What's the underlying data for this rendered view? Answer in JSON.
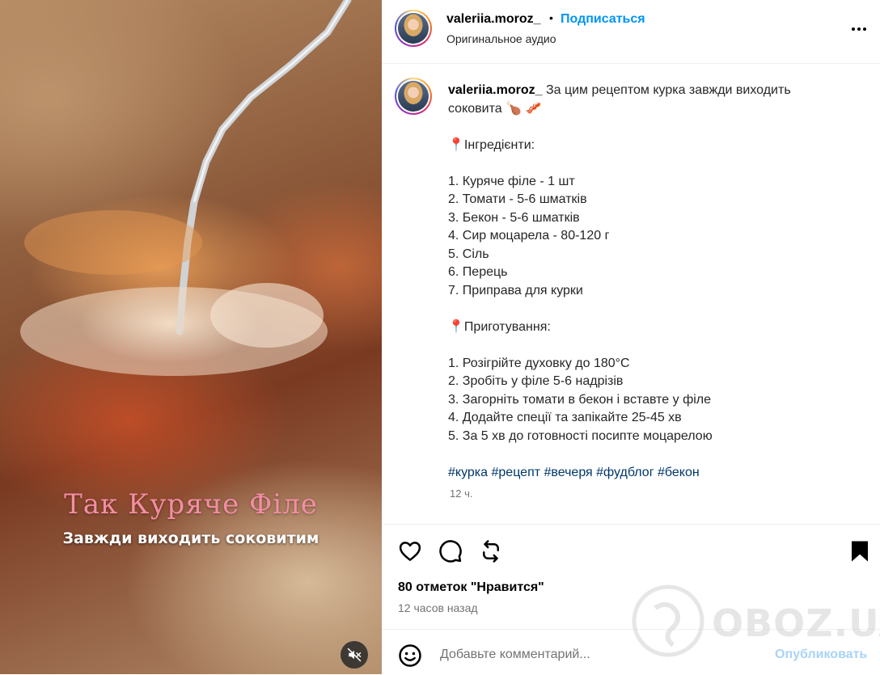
{
  "post": {
    "username": "valeriia.moroz_",
    "separator_dot": "•",
    "follow_label": "Подписаться",
    "audio_label": "Оригинальное аудио"
  },
  "media": {
    "overlay_title": "Так Куряче Філе",
    "overlay_subtitle": "Завжди виходить соковитим"
  },
  "caption": {
    "username": "valeriia.moroz_",
    "lines": [
      " За цим рецептом курка завжди виходить",
      "соковита 🍗 🥓",
      "",
      "📍Інгредієнти:",
      "",
      "1. Куряче філе - 1 шт",
      "2. Томати - 5-6 шматків",
      "3. Бекон - 5-6 шматків",
      "4. Сир моцарела - 80-120 г",
      "5. Сіль",
      "6. Перець",
      "7. Приправа для курки",
      "",
      "📍Приготування:",
      "",
      "1. Розігрійте духовку до 180°C",
      "2. Зробіть у філе 5-6 надрізів",
      "3. Загорніть томати в бекон і вставте у філе",
      "4. Додайте спеції та запікайте 25-45 хв",
      "5. За 5 хв до готовності посипте моцарелою",
      ""
    ],
    "hashtags": "#курка #рецепт #вечеря #фудблог #бекон",
    "time": "12 ч."
  },
  "engagement": {
    "likes": "80 отметок \"Нравится\"",
    "time_ago": "12 часов назад"
  },
  "comment": {
    "placeholder": "Добавьте комментарий...",
    "publish_label": "Опубликовать"
  },
  "watermark": {
    "text": "OBOZ.UA"
  },
  "icons": {
    "like": "heart-icon",
    "comment": "comment-icon",
    "share": "repost-icon",
    "save": "bookmark-icon",
    "more": "more-icon",
    "emoji": "emoji-icon",
    "mute": "speaker-muted-icon"
  },
  "colors": {
    "link_blue": "#0095f6",
    "hashtag": "#00376b",
    "publish_disabled": "#a9d3f7",
    "overlay_title": "#f58da4"
  }
}
